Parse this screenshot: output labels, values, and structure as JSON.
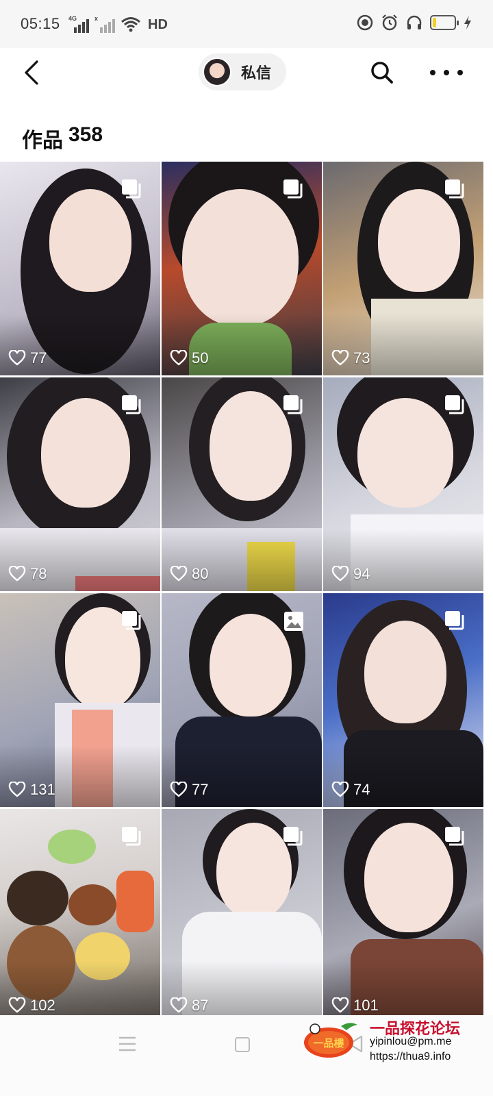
{
  "status_bar": {
    "time": "05:15",
    "network1": "4G",
    "network2": "x",
    "hd": "HD",
    "battery_level_pct": 18,
    "icons": [
      "signal-icon",
      "wifi-icon",
      "dnd-icon",
      "alarm-icon",
      "headphones-icon",
      "battery-icon",
      "charging-icon"
    ]
  },
  "header": {
    "back_icon": "chevron-left-icon",
    "dm_label": "私信",
    "search_icon": "search-icon",
    "more_icon": "more-horizontal-icon"
  },
  "works": {
    "label": "作品",
    "count": "358"
  },
  "grid": {
    "tiles": [
      {
        "likes": "77",
        "type": "multi-image"
      },
      {
        "likes": "50",
        "type": "multi-image"
      },
      {
        "likes": "73",
        "type": "multi-image"
      },
      {
        "likes": "78",
        "type": "multi-image"
      },
      {
        "likes": "80",
        "type": "multi-image"
      },
      {
        "likes": "94",
        "type": "multi-image"
      },
      {
        "likes": "131",
        "type": "multi-image"
      },
      {
        "likes": "77",
        "type": "single-image"
      },
      {
        "likes": "74",
        "type": "multi-image"
      },
      {
        "likes": "102",
        "type": "multi-image"
      },
      {
        "likes": "87",
        "type": "multi-image"
      },
      {
        "likes": "101",
        "type": "multi-image"
      }
    ]
  },
  "system_nav": {
    "icons": [
      "menu-icon",
      "home-icon",
      "back-triangle-icon"
    ]
  },
  "watermark": {
    "logo_text": "一品樓",
    "title": "一品探花论坛",
    "line1": "yipinlou@pm.me",
    "line2": "https://thua9.info"
  }
}
